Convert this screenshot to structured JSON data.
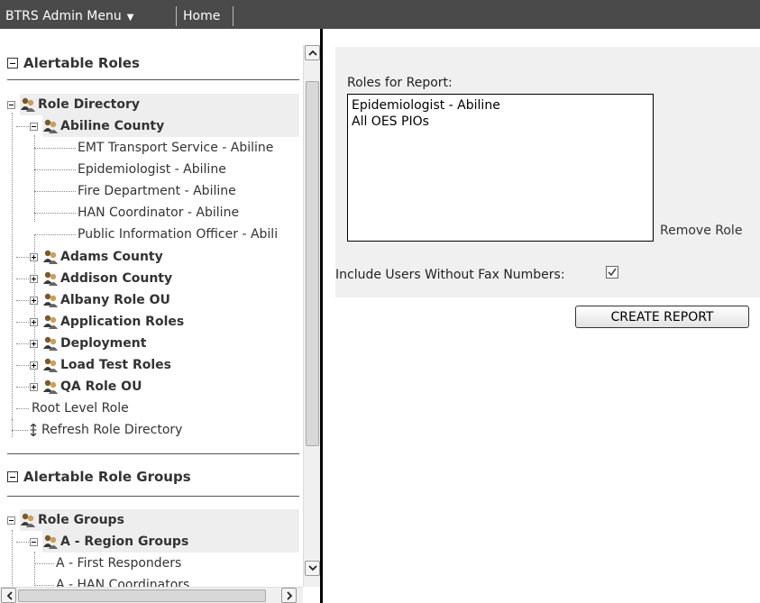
{
  "topbar": {
    "admin_menu_label": "BTRS Admin Menu",
    "admin_menu_caret": "▼",
    "home_label": "Home"
  },
  "alertable_roles": {
    "header": "Alertable Roles",
    "tree": {
      "root": "Role Directory",
      "expanded_county": "Abiline County",
      "abiline_roles": [
        "EMT Transport Service - Abiline",
        "Epidemiologist - Abiline",
        "Fire Department - Abiline",
        "HAN Coordinator - Abiline",
        "Public Information Officer - Abili"
      ],
      "collapsed_nodes": [
        "Adams County",
        "Addison County",
        "Albany Role OU",
        "Application Roles",
        "Deployment",
        "Load Test Roles",
        "QA Role OU"
      ],
      "root_level_role": "Root Level Role",
      "refresh_label": "Refresh Role Directory",
      "refresh_icon": "refresh-icon"
    }
  },
  "alertable_role_groups": {
    "header": "Alertable Role Groups",
    "tree": {
      "root": "Role Groups",
      "expanded_group": "A - Region Groups",
      "items": [
        "A - First Responders",
        "A - HAN Coordinators"
      ]
    }
  },
  "report": {
    "roles_label": "Roles for Report:",
    "roles": [
      "Epidemiologist - Abiline",
      "All OES PIOs"
    ],
    "remove_role_label": "Remove Role",
    "fax_label": "Include Users Without Fax Numbers:",
    "fax_checked": true,
    "create_button_label": "CREATE REPORT"
  },
  "colors": {
    "topbar_bg": "#4a4a4a",
    "panel_bg": "#f0f0f0",
    "tree_highlight": "#eeeeee"
  }
}
